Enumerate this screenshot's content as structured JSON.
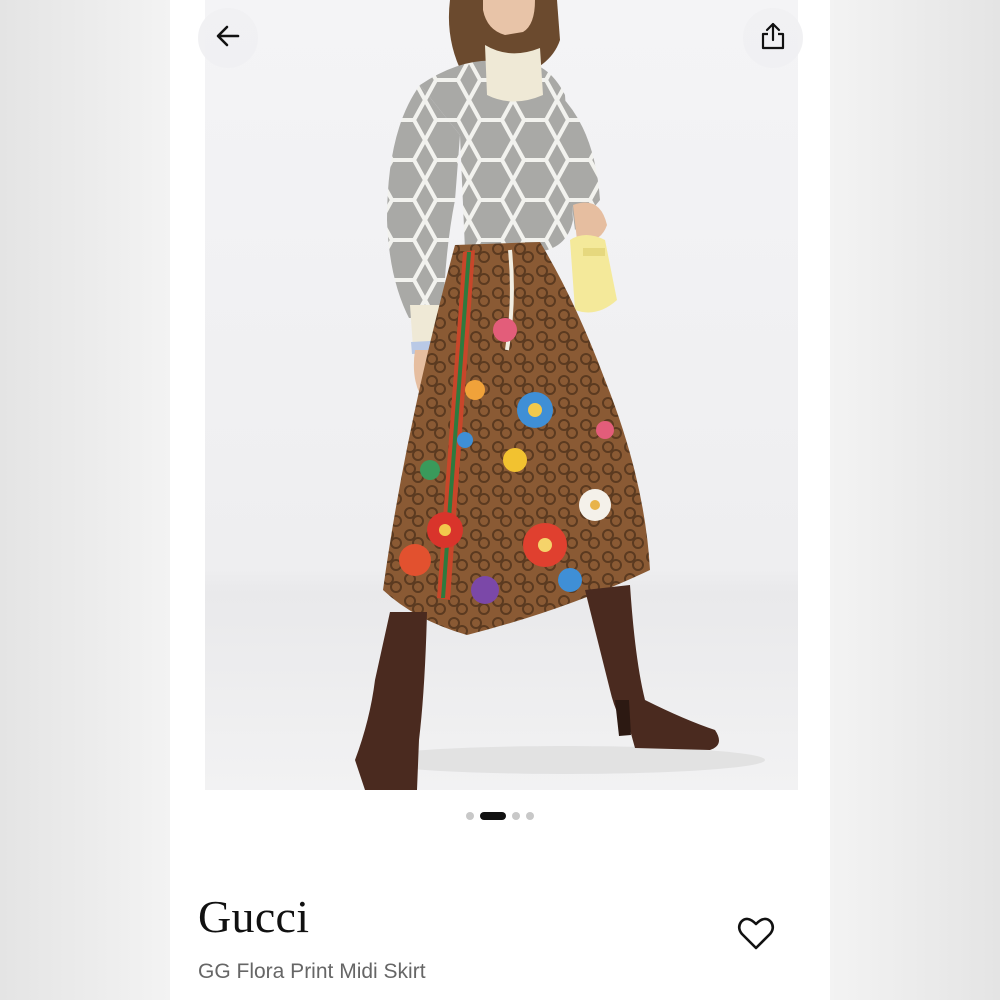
{
  "product": {
    "brand": "Gucci",
    "name": "GG Flora Print Midi Skirt"
  },
  "gallery": {
    "image_count": 4,
    "active_index": 1
  },
  "icons": {
    "back": "arrow-left-icon",
    "share": "share-icon",
    "favorite": "heart-outline-icon"
  },
  "colors": {
    "text_primary": "#111111",
    "text_secondary": "#666666",
    "dot_active": "#111111",
    "dot_inactive": "#c8c8c8"
  }
}
